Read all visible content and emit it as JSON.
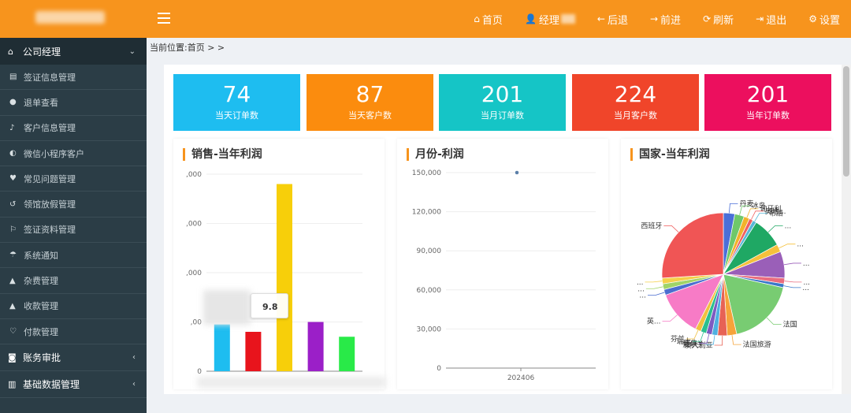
{
  "header": {
    "nav": [
      {
        "icon": "home-icon",
        "glyph": "⌂",
        "label": "首页"
      },
      {
        "icon": "user-icon",
        "glyph": "👤",
        "label": "经理"
      },
      {
        "icon": "arrow-left-icon",
        "glyph": "←",
        "label": "后退"
      },
      {
        "icon": "arrow-right-icon",
        "glyph": "→",
        "label": "前进"
      },
      {
        "icon": "refresh-icon",
        "glyph": "⟳",
        "label": "刷新"
      },
      {
        "icon": "logout-icon",
        "glyph": "⇥",
        "label": "退出"
      },
      {
        "icon": "gears-icon",
        "glyph": "⚙",
        "label": "设置"
      }
    ]
  },
  "sidebar": {
    "group1": {
      "label": "公司经理",
      "icon": "home-icon"
    },
    "items": [
      {
        "label": "签证信息管理",
        "icon": "briefcase-icon",
        "glyph": "▤"
      },
      {
        "label": "退单查看",
        "icon": "user-icon",
        "glyph": "●"
      },
      {
        "label": "客户信息管理",
        "icon": "bell-icon",
        "glyph": "♪"
      },
      {
        "label": "微信小程序客户",
        "icon": "car-icon",
        "glyph": "◐"
      },
      {
        "label": "常见问题管理",
        "icon": "heart-icon",
        "glyph": "♥"
      },
      {
        "label": "领馆放假管理",
        "icon": "history-icon",
        "glyph": "↺"
      },
      {
        "label": "签证资料管理",
        "icon": "flag-icon",
        "glyph": "⚐"
      },
      {
        "label": "系统通知",
        "icon": "umbrella-icon",
        "glyph": "☂"
      },
      {
        "label": "杂费管理",
        "icon": "warning-icon",
        "glyph": "▲"
      },
      {
        "label": "收款管理",
        "icon": "warning-icon",
        "glyph": "▲"
      },
      {
        "label": "付款管理",
        "icon": "heart-outline-icon",
        "glyph": "♡"
      }
    ],
    "group2": {
      "label": "账务审批",
      "icon": "camera-icon"
    },
    "group3": {
      "label": "基础数据管理",
      "icon": "bar-chart-icon"
    }
  },
  "breadcrumb": "当前位置:首页 > >",
  "stats": [
    {
      "value": "74",
      "label": "当天订单数",
      "color": "#1ebdf0"
    },
    {
      "value": "87",
      "label": "当天客户数",
      "color": "#fb8c0e"
    },
    {
      "value": "201",
      "label": "当月订单数",
      "color": "#15c5c6"
    },
    {
      "value": "224",
      "label": "当月客户数",
      "color": "#f0452a"
    },
    {
      "value": "201",
      "label": "当年订单数",
      "color": "#ec0f5e"
    }
  ],
  "cards": {
    "sales_title": "销售-当年利润",
    "month_title": "月份-利润",
    "country_title": "国家-当年利润"
  },
  "tooltip_text": "9.8",
  "chart_data": [
    {
      "type": "bar",
      "title": "销售-当年利润",
      "y_tick_labels": [
        ",000",
        ",000",
        ",000",
        ",00",
        "0"
      ],
      "series": [
        {
          "values": [
            0.19,
            0.16,
            0.76,
            0.2,
            0.14
          ],
          "colors": [
            "#1ebdf0",
            "#e8141c",
            "#f7cf0a",
            "#9b1fc8",
            "#29ea48"
          ]
        }
      ]
    },
    {
      "type": "scatter",
      "title": "月份-利润",
      "ylim": [
        0,
        150000
      ],
      "y_tick_labels": [
        "0",
        "30,000",
        "60,000",
        "90,000",
        "120,000",
        "150,000"
      ],
      "x_tick_labels": [
        "202406"
      ],
      "points": [
        {
          "x": "202406",
          "y": 150000
        }
      ]
    },
    {
      "type": "pie",
      "title": "国家-当年利润",
      "slices": [
        {
          "label": "丹麦",
          "value": 3,
          "color": "#4a6fd8"
        },
        {
          "label": "冰岛",
          "value": 2.5,
          "color": "#6fc86a"
        },
        {
          "label": "匈牙利",
          "value": 1.5,
          "color": "#f2b32b"
        },
        {
          "label": "奥地...",
          "value": 1,
          "color": "#f06060"
        },
        {
          "label": "希腊",
          "value": 1,
          "color": "#58b8d8"
        },
        {
          "label": "...",
          "value": 8,
          "color": "#1fa864"
        },
        {
          "label": "...",
          "value": 2,
          "color": "#f5c13b"
        },
        {
          "label": "...",
          "value": 7,
          "color": "#9a5fb8"
        },
        {
          "label": "...",
          "value": 1.5,
          "color": "#e96c7f"
        },
        {
          "label": "...",
          "value": 1,
          "color": "#3a78c9"
        },
        {
          "label": "法国",
          "value": 18,
          "color": "#78cc72"
        },
        {
          "label": "法国旅游",
          "value": 2.5,
          "color": "#f6a33a"
        },
        {
          "label": "澳大利亚",
          "value": 2.5,
          "color": "#e76255"
        },
        {
          "label": "爱尔兰",
          "value": 1.5,
          "color": "#4fb0e0"
        },
        {
          "label": "瑞典",
          "value": 1.5,
          "color": "#7d5bc2"
        },
        {
          "label": "瑞士",
          "value": 1.5,
          "color": "#2bbf8f"
        },
        {
          "label": "芬兰",
          "value": 1.5,
          "color": "#f0c040"
        },
        {
          "label": "英...",
          "value": 12,
          "color": "#f77bc6"
        },
        {
          "label": "...",
          "value": 1.5,
          "color": "#4b6ed0"
        },
        {
          "label": "...",
          "value": 1.5,
          "color": "#a0d468"
        },
        {
          "label": "...",
          "value": 1.5,
          "color": "#f5d04a"
        },
        {
          "label": "西班牙",
          "value": 26,
          "color": "#f05555"
        }
      ]
    }
  ]
}
